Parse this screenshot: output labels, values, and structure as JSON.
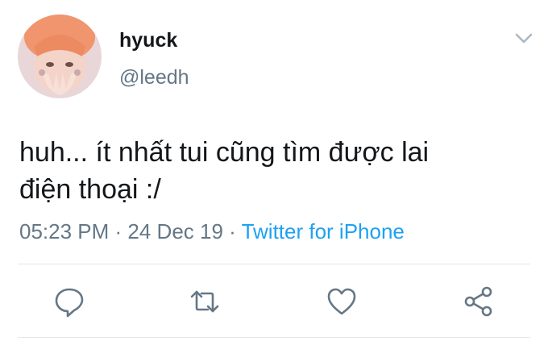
{
  "tweet": {
    "display_name": "hyuck",
    "handle": "@leedh",
    "text_line1": "huh... ít nhất tui cũng tìm được lai",
    "text_line2": "điện thoại :/",
    "time": "05:23 PM",
    "separator1": " · ",
    "date": "24 Dec 19",
    "separator2": " · ",
    "source": "Twitter for iPhone"
  },
  "icons": {
    "caret": "chevron-down-icon",
    "reply": "reply-icon",
    "retweet": "retweet-icon",
    "like": "heart-icon",
    "share": "share-icon"
  },
  "colors": {
    "text": "#14171a",
    "secondary": "#657786",
    "link": "#1da1f2",
    "divider": "#e1e8ed"
  }
}
